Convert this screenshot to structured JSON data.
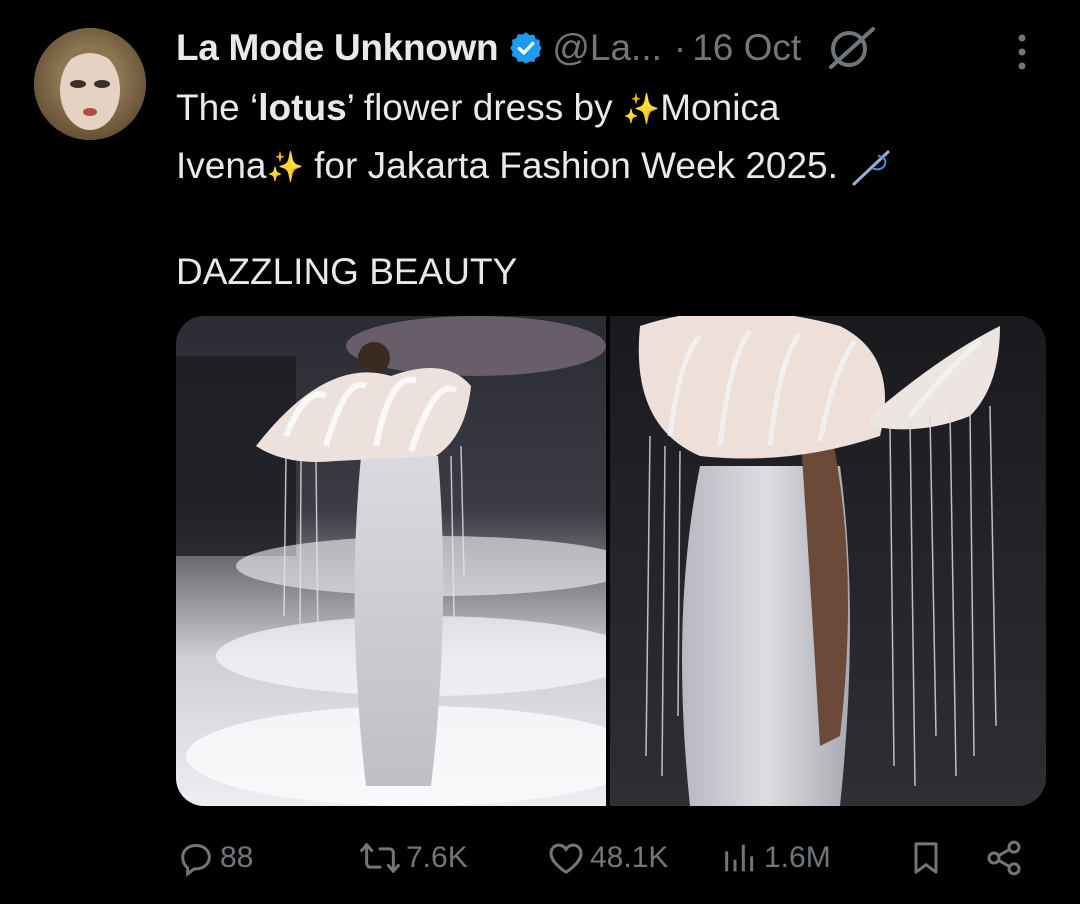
{
  "tweet": {
    "author_name": "La Mode Unknown",
    "handle": "@La...",
    "separator": "·",
    "date": "16 Oct",
    "text": {
      "t1": "The ‘",
      "t1_bold": "lotus",
      "t1_end": "’ flower dress by ",
      "t1_tail": "Monica",
      "t2_start": "Ivena",
      "t2_mid": " for Jakarta Fashion Week 2025. ",
      "sparkle": "✨"
    },
    "text2": "DAZZLING BEAUTY"
  },
  "actions": {
    "replies": "88",
    "retweets": "7.6K",
    "likes": "48.1K",
    "views": "1.6M"
  },
  "colors": {
    "background": "#000000",
    "text": "#e7e9ea",
    "muted": "#71767b",
    "verified": "#1d9bf0"
  }
}
